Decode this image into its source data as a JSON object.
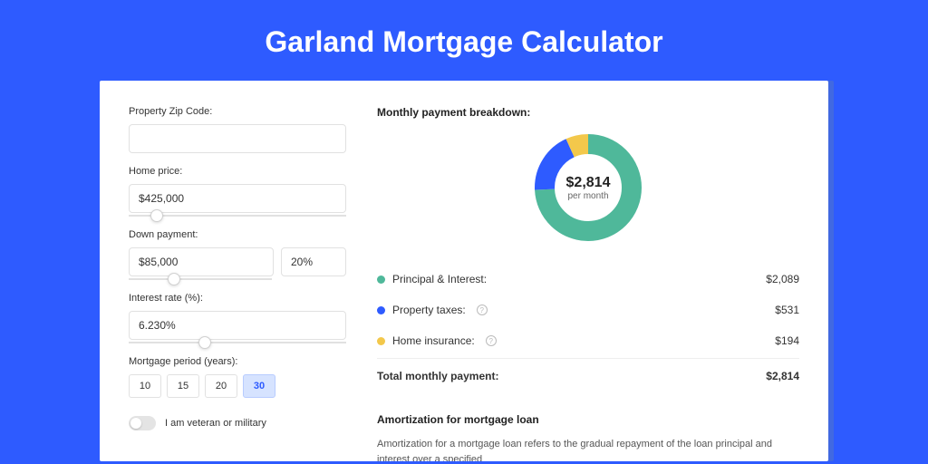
{
  "title": "Garland Mortgage Calculator",
  "form": {
    "zip": {
      "label": "Property Zip Code:",
      "value": ""
    },
    "homePrice": {
      "label": "Home price:",
      "value": "$425,000",
      "sliderPercent": 10
    },
    "downPayment": {
      "label": "Down payment:",
      "amount": "$85,000",
      "percent": "20%",
      "sliderPercent": 20
    },
    "interestRate": {
      "label": "Interest rate (%):",
      "value": "6.230%",
      "sliderPercent": 32
    },
    "period": {
      "label": "Mortgage period (years):",
      "options": [
        "10",
        "15",
        "20",
        "30"
      ],
      "active": "30"
    },
    "veteran": {
      "label": "I am veteran or military",
      "checked": false
    }
  },
  "breakdown": {
    "title": "Monthly payment breakdown:",
    "centerAmount": "$2,814",
    "centerSub": "per month",
    "items": [
      {
        "label": "Principal & Interest:",
        "value": "$2,089",
        "color": "#4fb89a",
        "help": false
      },
      {
        "label": "Property taxes:",
        "value": "$531",
        "color": "#2e5bff",
        "help": true
      },
      {
        "label": "Home insurance:",
        "value": "$194",
        "color": "#f3c84b",
        "help": true
      }
    ],
    "totalLabel": "Total monthly payment:",
    "totalValue": "$2,814"
  },
  "chart_data": {
    "type": "pie",
    "title": "Monthly payment breakdown",
    "series": [
      {
        "name": "Principal & Interest",
        "value": 2089,
        "color": "#4fb89a"
      },
      {
        "name": "Property taxes",
        "value": 531,
        "color": "#2e5bff"
      },
      {
        "name": "Home insurance",
        "value": 194,
        "color": "#f3c84b"
      }
    ],
    "total": 2814
  },
  "amortization": {
    "title": "Amortization for mortgage loan",
    "body": "Amortization for a mortgage loan refers to the gradual repayment of the loan principal and interest over a specified"
  }
}
